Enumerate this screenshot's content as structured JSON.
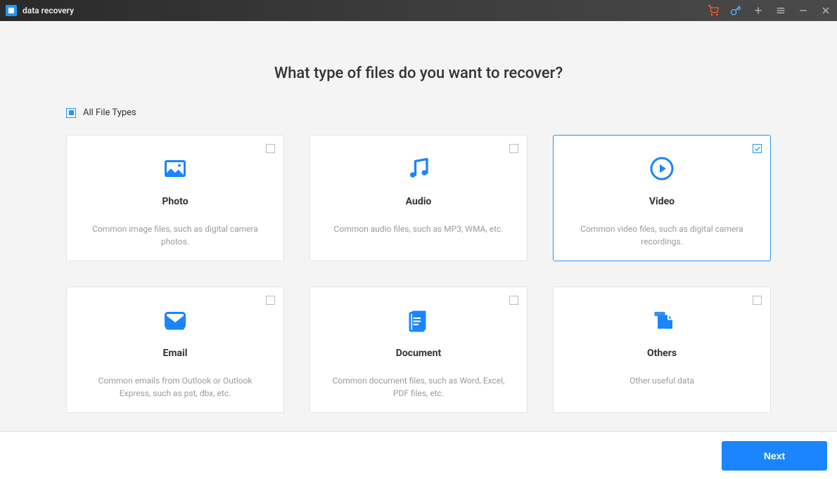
{
  "header": {
    "app_title": "data recovery"
  },
  "colors": {
    "accent": "#2196F3",
    "primary_button": "#1a85ff"
  },
  "page_title": "What type of files do you want to recover?",
  "all_types_label": "All File Types",
  "cards": [
    {
      "title": "Photo",
      "desc": "Common image files, such as digital camera photos.",
      "selected": false
    },
    {
      "title": "Audio",
      "desc": "Common audio files, such as MP3, WMA, etc.",
      "selected": false
    },
    {
      "title": "Video",
      "desc": "Common video files, such as digital camera recordings.",
      "selected": true
    },
    {
      "title": "Email",
      "desc": "Common emails from Outlook or Outlook Express, such as pst, dbx, etc.",
      "selected": false
    },
    {
      "title": "Document",
      "desc": "Common document files, such as Word, Excel, PDF files, etc.",
      "selected": false
    },
    {
      "title": "Others",
      "desc": "Other useful data",
      "selected": false
    }
  ],
  "footer": {
    "next_label": "Next"
  }
}
